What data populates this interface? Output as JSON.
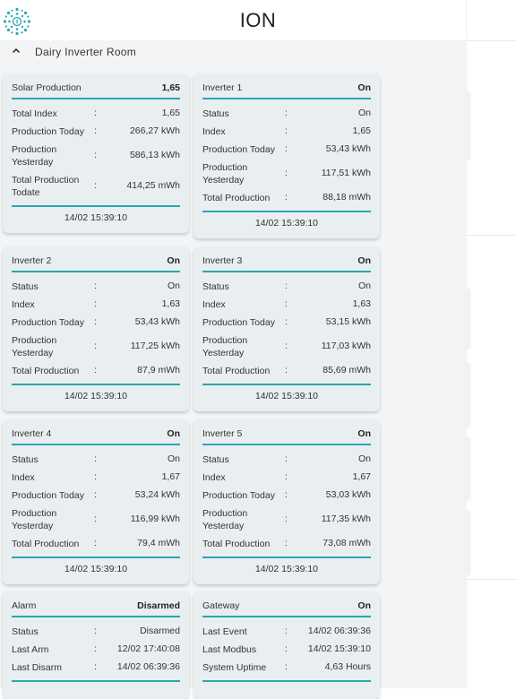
{
  "app": {
    "title": "ION",
    "logo": "ion-logo-icon",
    "accent": "#2aa6b4"
  },
  "section": {
    "label": "Dairy Inverter Room",
    "icon": "chevron-up-icon"
  },
  "cards": {
    "solar": {
      "title": "Solar Production",
      "value": "1,65",
      "rows": [
        {
          "label": "Total Index",
          "value": "1,65"
        },
        {
          "label": "Production Today",
          "value": "266,27 kWh"
        },
        {
          "label": "Production Yesterday",
          "value": "586,13 kWh"
        },
        {
          "label": "Total Production Todate",
          "value": "414,25 mWh"
        }
      ],
      "timestamp": "14/02 15:39:10"
    },
    "inv1": {
      "title": "Inverter 1",
      "value": "On",
      "rows": [
        {
          "label": "Status",
          "value": "On"
        },
        {
          "label": "Index",
          "value": "1,65"
        },
        {
          "label": "Production Today",
          "value": "53,43 kWh"
        },
        {
          "label": "Production Yesterday",
          "value": "117,51 kWh"
        },
        {
          "label": "Total Production",
          "value": "88,18 mWh"
        }
      ],
      "timestamp": "14/02 15:39:10"
    },
    "inv2": {
      "title": "Inverter 2",
      "value": "On",
      "rows": [
        {
          "label": "Status",
          "value": "On"
        },
        {
          "label": "Index",
          "value": "1,63"
        },
        {
          "label": "Production Today",
          "value": "53,43 kWh"
        },
        {
          "label": "Production Yesterday",
          "value": "117,25 kWh"
        },
        {
          "label": "Total Production",
          "value": "87,9 mWh"
        }
      ],
      "timestamp": "14/02 15:39:10"
    },
    "inv3": {
      "title": "Inverter 3",
      "value": "On",
      "rows": [
        {
          "label": "Status",
          "value": "On"
        },
        {
          "label": "Index",
          "value": "1,63"
        },
        {
          "label": "Production Today",
          "value": "53,15 kWh"
        },
        {
          "label": "Production Yesterday",
          "value": "117,03 kWh"
        },
        {
          "label": "Total Production",
          "value": "85,69 mWh"
        }
      ],
      "timestamp": "14/02 15:39:10"
    },
    "inv4": {
      "title": "Inverter 4",
      "value": "On",
      "rows": [
        {
          "label": "Status",
          "value": "On"
        },
        {
          "label": "Index",
          "value": "1,67"
        },
        {
          "label": "Production Today",
          "value": "53,24 kWh"
        },
        {
          "label": "Production Yesterday",
          "value": "116,99 kWh"
        },
        {
          "label": "Total Production",
          "value": "79,4 mWh"
        }
      ],
      "timestamp": "14/02 15:39:10"
    },
    "inv5": {
      "title": "Inverter 5",
      "value": "On",
      "rows": [
        {
          "label": "Status",
          "value": "On"
        },
        {
          "label": "Index",
          "value": "1,67"
        },
        {
          "label": "Production Today",
          "value": "53,03 kWh"
        },
        {
          "label": "Production Yesterday",
          "value": "117,35 kWh"
        },
        {
          "label": "Total Production",
          "value": "73,08 mWh"
        }
      ],
      "timestamp": "14/02 15:39:10"
    },
    "alarm": {
      "title": "Alarm",
      "value": "Disarmed",
      "rows": [
        {
          "label": "Status",
          "value": "Disarmed"
        },
        {
          "label": "Last Arm",
          "value": "12/02 17:40:08"
        },
        {
          "label": "Last Disarm",
          "value": "14/02 06:39:36"
        }
      ]
    },
    "gateway": {
      "title": "Gateway",
      "value": "On",
      "rows": [
        {
          "label": "Last Event",
          "value": "14/02 06:39:36"
        },
        {
          "label": "Last Modbus",
          "value": "14/02 15:39:10"
        },
        {
          "label": "System Uptime",
          "value": "4,63 Hours"
        }
      ]
    }
  }
}
